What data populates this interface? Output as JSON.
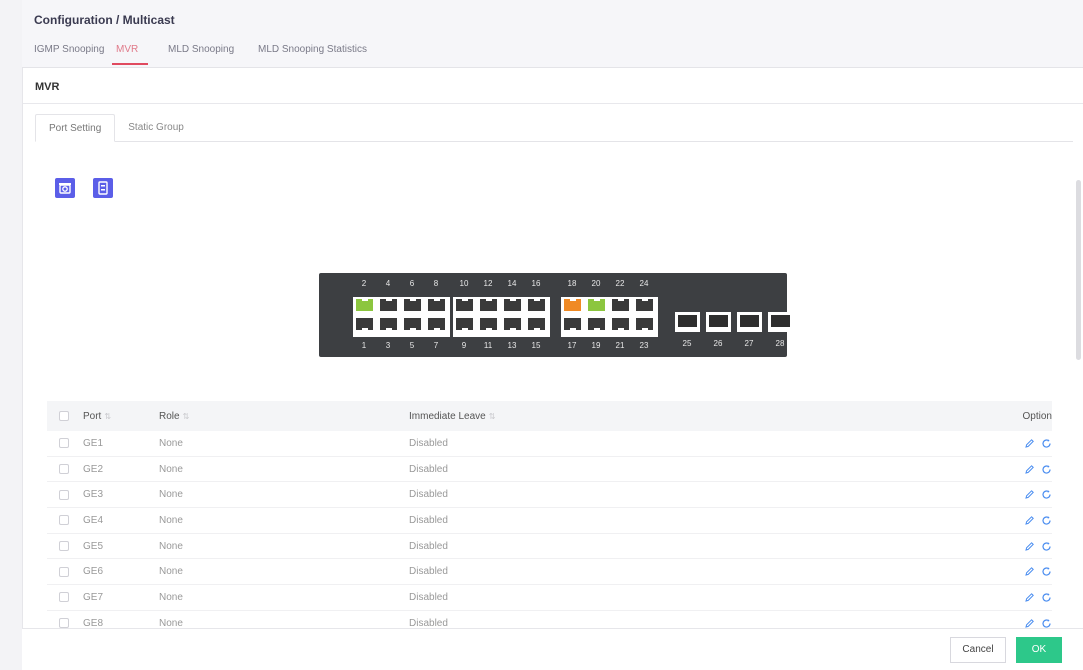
{
  "breadcrumb": "Configuration / Multicast",
  "tabs": [
    "IGMP Snooping",
    "MVR",
    "MLD Snooping",
    "MLD Snooping Statistics"
  ],
  "active_tab": "MVR",
  "panel_title": "MVR",
  "subtabs": [
    "Port Setting",
    "Static Group"
  ],
  "active_subtab": "Port Setting",
  "switch": {
    "top_labels": [
      "2",
      "4",
      "6",
      "8",
      "10",
      "12",
      "14",
      "16",
      "18",
      "20",
      "22",
      "24"
    ],
    "bottom_labels": [
      "1",
      "3",
      "5",
      "7",
      "9",
      "11",
      "13",
      "15",
      "17",
      "19",
      "21",
      "23"
    ],
    "sfp_labels": [
      "25",
      "26",
      "27",
      "28"
    ],
    "port_status": {
      "2": "green",
      "18": "orange",
      "20": "green"
    },
    "colors": {
      "green": "#8cc63f",
      "orange": "#f08a24"
    }
  },
  "table": {
    "headers": {
      "port": "Port",
      "role": "Role",
      "leave": "Immediate Leave",
      "option": "Option"
    },
    "rows": [
      {
        "port": "GE1",
        "role": "None",
        "leave": "Disabled"
      },
      {
        "port": "GE2",
        "role": "None",
        "leave": "Disabled"
      },
      {
        "port": "GE3",
        "role": "None",
        "leave": "Disabled"
      },
      {
        "port": "GE4",
        "role": "None",
        "leave": "Disabled"
      },
      {
        "port": "GE5",
        "role": "None",
        "leave": "Disabled"
      },
      {
        "port": "GE6",
        "role": "None",
        "leave": "Disabled"
      },
      {
        "port": "GE7",
        "role": "None",
        "leave": "Disabled"
      },
      {
        "port": "GE8",
        "role": "None",
        "leave": "Disabled"
      }
    ]
  },
  "icons": {
    "toolbar": [
      "camera-icon",
      "document-icon"
    ],
    "row_options": [
      "edit-icon",
      "refresh-icon"
    ]
  },
  "buttons": {
    "cancel": "Cancel",
    "ok": "OK"
  },
  "accent_colors": {
    "primary": "#5b5ee8",
    "ok": "#2dc88a",
    "active_tab": "#e04a5f",
    "option_icon": "#4a8df0"
  }
}
